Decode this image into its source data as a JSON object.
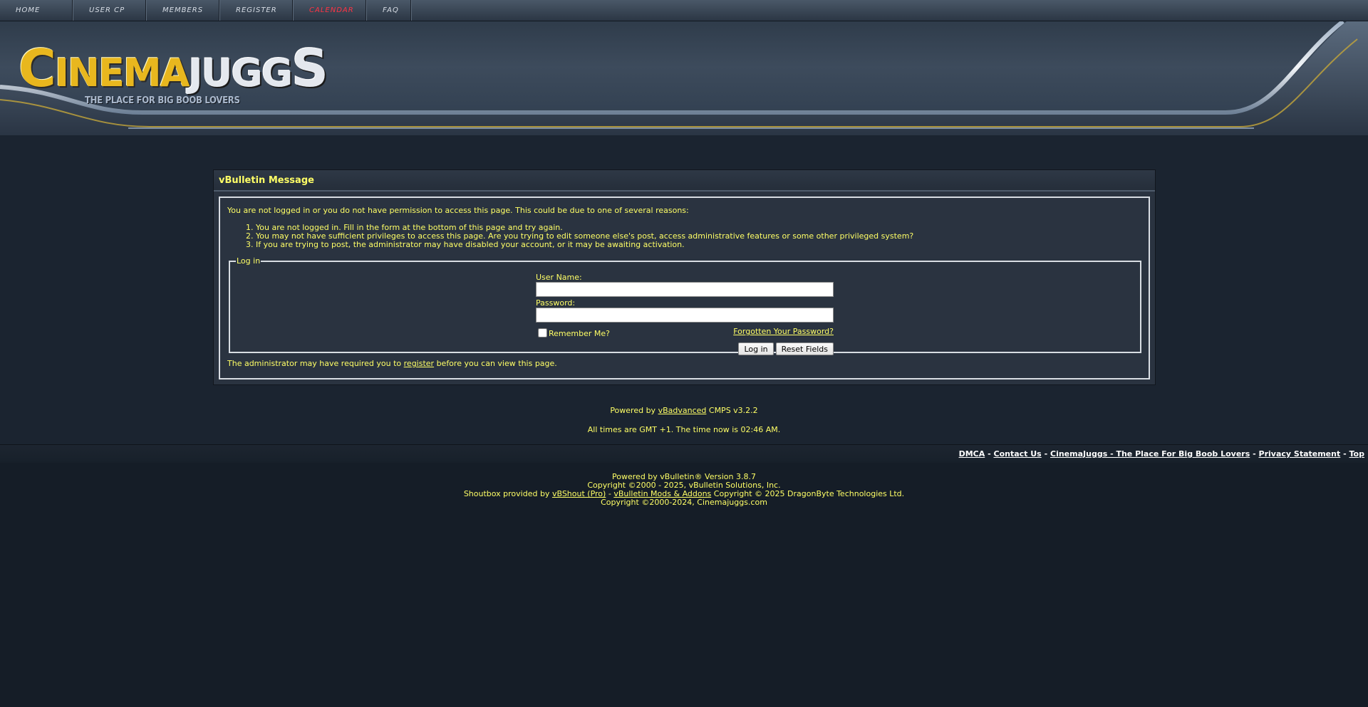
{
  "nav": {
    "items": [
      {
        "label": "HOME"
      },
      {
        "label": "USER CP"
      },
      {
        "label": "MEMBERS"
      },
      {
        "label": "REGISTER"
      },
      {
        "label": "CALENDAR"
      },
      {
        "label": "FAQ"
      }
    ]
  },
  "logo": {
    "c": "C",
    "inema": "INEMA",
    "j": "J",
    "ugg": "UGG",
    "s": "S",
    "tagline": "THE PLACE FOR BIG BOOB LOVERS"
  },
  "message": {
    "title": "vBulletin Message",
    "intro": "You are not logged in or you do not have permission to access this page. This could be due to one of several reasons:",
    "reasons": [
      "You are not logged in. Fill in the form at the bottom of this page and try again.",
      "You may not have sufficient privileges to access this page. Are you trying to edit someone else's post, access administrative features or some other privileged system?",
      "If you are trying to post, the administrator may have disabled your account, or it may be awaiting activation."
    ],
    "login": {
      "legend": "Log in",
      "username_label": "User Name:",
      "username_value": "",
      "password_label": "Password:",
      "password_value": "",
      "remember_label": "Remember Me?",
      "forgot_link": "Forgotten Your Password?",
      "login_button": "Log in",
      "reset_button": "Reset Fields"
    },
    "admin_note_pre": "The administrator may have required you to",
    "admin_note_link": "register",
    "admin_note_post": "before you can view this page."
  },
  "powered": {
    "pre": "Powered by",
    "link": "vBadvanced",
    "post": "CMPS v3.2.2"
  },
  "times": "All times are GMT +1. The time now is 02:46 AM.",
  "footer_links": {
    "dmca": "DMCA",
    "contact": "Contact Us",
    "home": "CinemaJuggs - The Place For Big Boob Lovers",
    "privacy": "Privacy Statement",
    "top": "Top",
    "separator": "-"
  },
  "copyright": {
    "line1": "Powered by vBulletin® Version 3.8.7",
    "line2": "Copyright ©2000 - 2025, vBulletin Solutions, Inc.",
    "line3_pre": "Shoutbox provided by",
    "line3_link1": "vBShout (Pro)",
    "line3_sep": "-",
    "line3_link2": "vBulletin Mods & Addons",
    "line3_post": "Copyright © 2025 DragonByte Technologies Ltd.",
    "line4": "Copyright ©2000-2024, Cinemajuggs.com"
  },
  "colors": {
    "text": "#ffff66",
    "background": "#1b2430",
    "panel": "#2a3340",
    "calendar_active": "#ff3344"
  }
}
